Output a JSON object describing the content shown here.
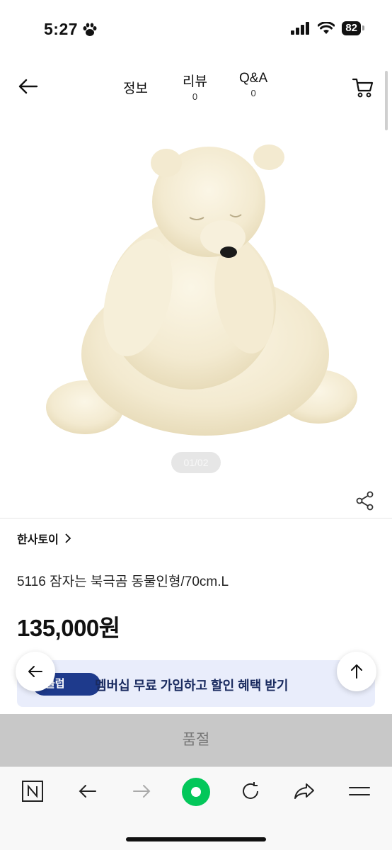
{
  "status_bar": {
    "time": "5:27",
    "battery": "82"
  },
  "nav": {
    "tabs": [
      {
        "label": "정보",
        "count": ""
      },
      {
        "label": "리뷰",
        "count": "0"
      },
      {
        "label": "Q&A",
        "count": "0"
      }
    ]
  },
  "product": {
    "image_counter": "01/02",
    "brand": "한사토이",
    "title": "5116 잠자는 북극곰 동물인형/70cm.L",
    "price": "135,000원"
  },
  "membership_banner": {
    "pill": "클럽",
    "text": "멤버십 무료 가입하고 할인 혜택 받기"
  },
  "buy_bar": {
    "label": "품절"
  },
  "browser_bar": {
    "items": [
      "n-icon",
      "back-arrow-icon",
      "forward-arrow-icon",
      "home-icon",
      "refresh-icon",
      "share-icon",
      "menu-icon"
    ],
    "accent": "#03c75a"
  }
}
